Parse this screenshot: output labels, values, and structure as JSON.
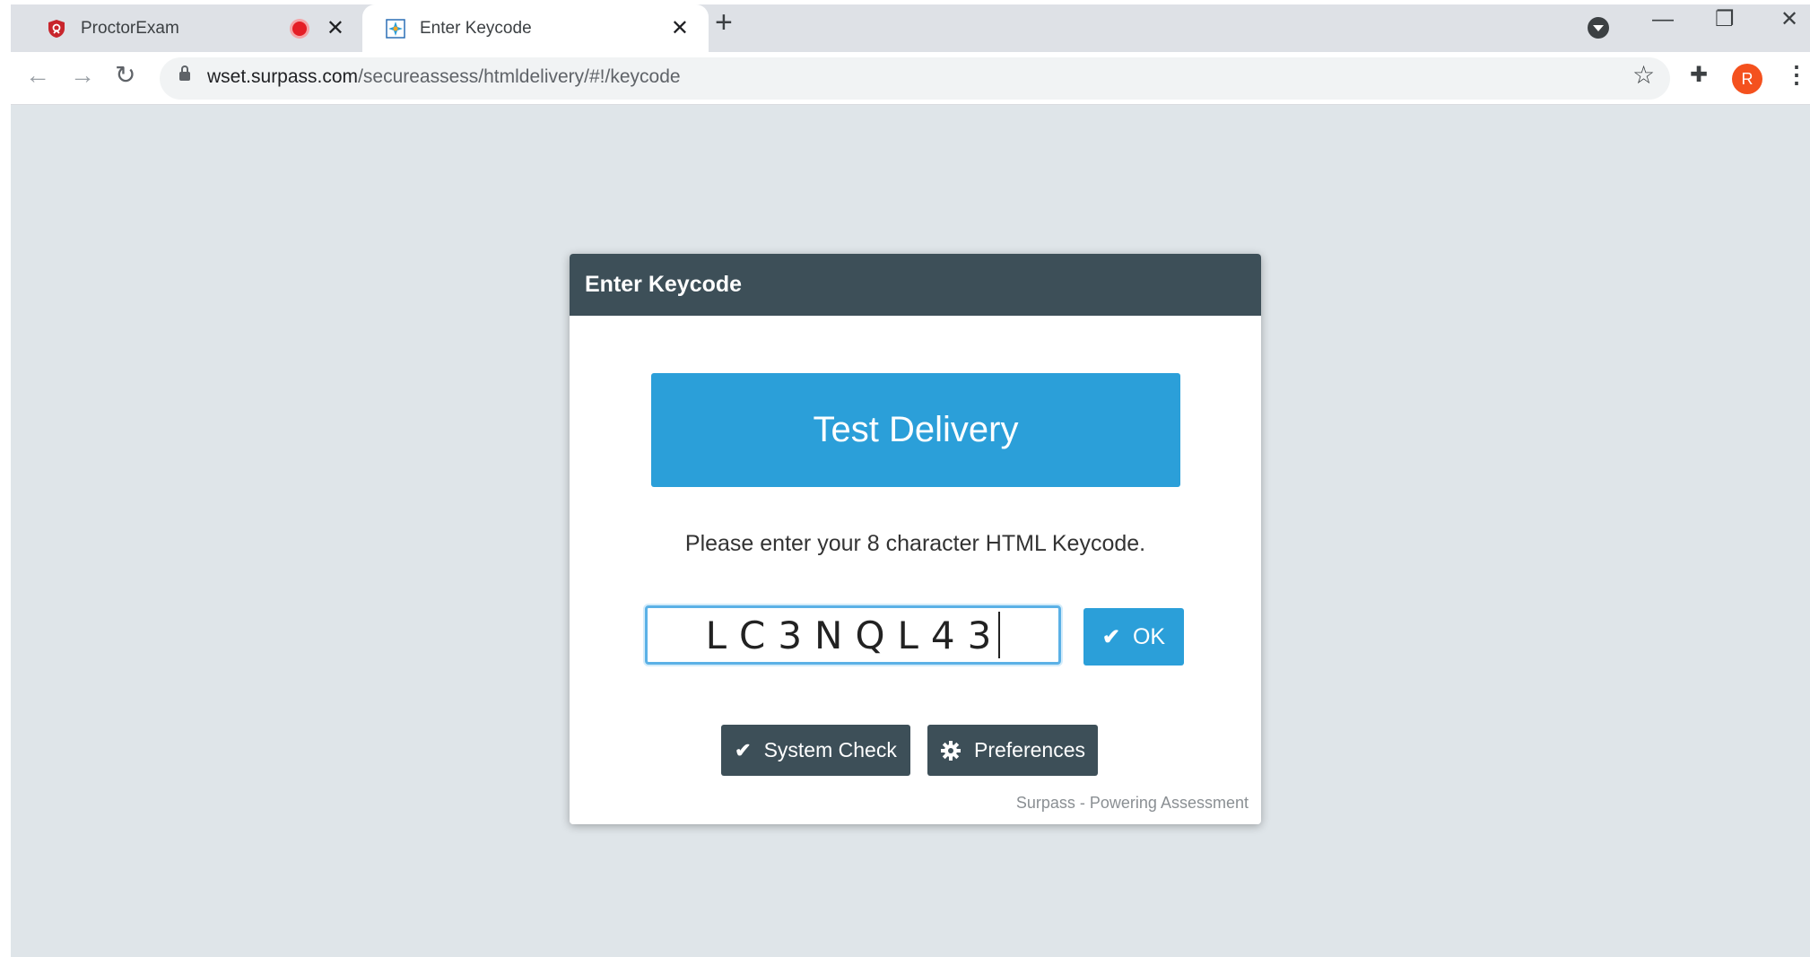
{
  "browser": {
    "tabs": [
      {
        "title": "ProctorExam",
        "favicon": "proctorexam-favicon",
        "recording": true
      },
      {
        "title": "Enter Keycode",
        "favicon": "surpass-favicon",
        "active": true
      }
    ],
    "close_glyph": "✕",
    "new_tab_glyph": "+",
    "url_host": "wset.surpass.com",
    "url_path": "/secureassess/htmldelivery/#!/keycode",
    "avatar_initial": "R",
    "window_controls": {
      "minimize": "—",
      "restore": "❐",
      "close": "✕"
    },
    "nav": {
      "back": "←",
      "forward": "→",
      "reload": "↻"
    },
    "bookmark_glyph": "☆",
    "extensions_glyph": "✚",
    "menu_glyph": "⋮"
  },
  "modal": {
    "header": "Enter Keycode",
    "banner": "Test Delivery",
    "instruction": "Please enter your 8 character HTML Keycode.",
    "keycode_value": "LC3NQL43",
    "ok_label": "OK",
    "system_check_label": "System Check",
    "preferences_label": "Preferences",
    "footer": "Surpass - Powering Assessment"
  },
  "colors": {
    "header_bg": "#3d4f58",
    "accent": "#2b9fd9",
    "page_bg": "#dfe5e9",
    "avatar": "#f4511e"
  }
}
